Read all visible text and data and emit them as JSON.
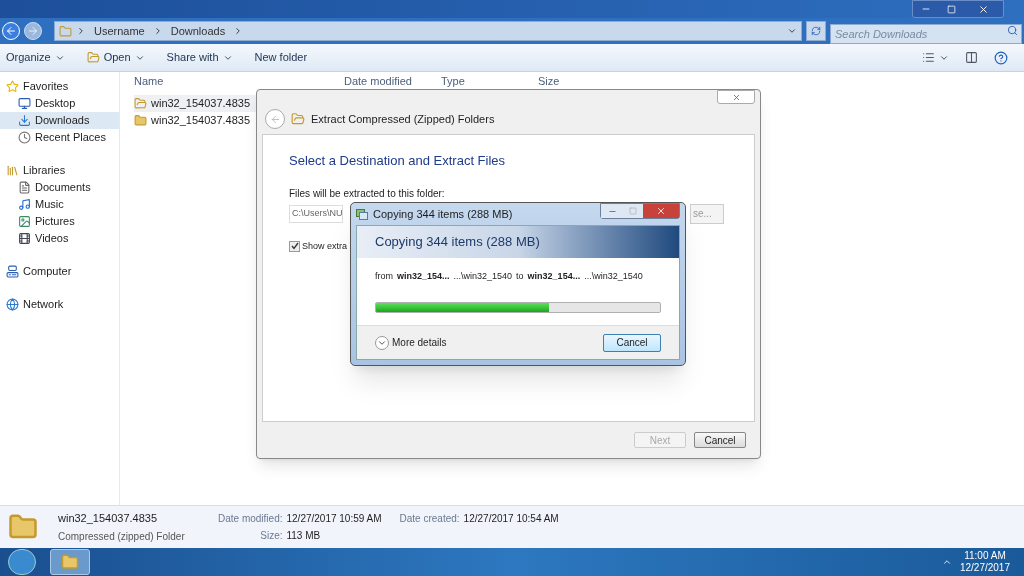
{
  "explorer": {
    "breadcrumb": [
      "Username",
      "Downloads"
    ],
    "search": {
      "placeholder": "Search Downloads"
    },
    "toolbar": [
      {
        "label": "Organize",
        "kind": "menu"
      },
      {
        "label": "Open",
        "kind": "open"
      },
      {
        "label": "Share with",
        "kind": "menu"
      },
      {
        "label": "New folder",
        "kind": "plain"
      }
    ],
    "sidebar": [
      {
        "label": "Favorites",
        "kind": "star",
        "selected": false,
        "children": [
          {
            "label": "Desktop",
            "kind": "desktop",
            "selected": false
          },
          {
            "label": "Downloads",
            "kind": "downloads",
            "selected": true
          },
          {
            "label": "Recent Places",
            "kind": "recent",
            "selected": false
          }
        ]
      },
      {
        "label": "Libraries",
        "kind": "libraries",
        "selected": false,
        "children": [
          {
            "label": "Documents",
            "kind": "document",
            "selected": false
          },
          {
            "label": "Music",
            "kind": "music",
            "selected": false
          },
          {
            "label": "Pictures",
            "kind": "picture",
            "selected": false
          },
          {
            "label": "Videos",
            "kind": "video",
            "selected": false
          }
        ]
      },
      {
        "label": "Computer",
        "kind": "computer",
        "selected": false
      },
      {
        "label": "Network",
        "kind": "network",
        "selected": false
      }
    ],
    "columns": [
      "Name",
      "Date modified",
      "Type",
      "Size"
    ],
    "files": [
      {
        "name": "win32_154037.4835",
        "kind": "zip",
        "selected": true
      },
      {
        "name": "win32_154037.4835",
        "kind": "folder",
        "selected": false
      }
    ]
  },
  "extract_dialog": {
    "title": "Extract Compressed (Zipped) Folders",
    "heading": "Select a Destination and Extract Files",
    "path_label": "Files will be extracted to this folder:",
    "path_value": "C:\\Users\\NU",
    "browse_button": "se...",
    "show_checkbox": {
      "label": "Show extra",
      "checked": true
    },
    "buttons": [
      {
        "label": "Next",
        "disabled": true
      },
      {
        "label": "Cancel",
        "disabled": false
      }
    ]
  },
  "copy_dialog": {
    "title": "Copying 344 items (288 MB)",
    "heading": "Copying 344 items (288 MB)",
    "from_line": [
      {
        "text": "from",
        "bold": false
      },
      {
        "text": "win32_154...",
        "bold": true
      },
      {
        "text": "...\\win32_1540",
        "bold": false
      },
      {
        "text": "to",
        "bold": false
      },
      {
        "text": "win32_154...",
        "bold": true
      },
      {
        "text": "...\\win32_1540",
        "bold": false
      }
    ],
    "progress": {
      "level": 0.61
    },
    "more_details": "More details",
    "cancel_button": "Cancel"
  },
  "details_pane": {
    "name": "win32_154037.4835",
    "type": "Compressed (zipped) Folder",
    "fields": [
      {
        "label": "Date modified:",
        "value": "12/27/2017 10:59 AM"
      },
      {
        "label": "Size:",
        "value": "113 MB"
      },
      {
        "label": "Date created:",
        "value": "12/27/2017 10:54 AM"
      }
    ]
  },
  "taskbar": {
    "time": "11:00 AM",
    "date": "12/27/2017"
  }
}
